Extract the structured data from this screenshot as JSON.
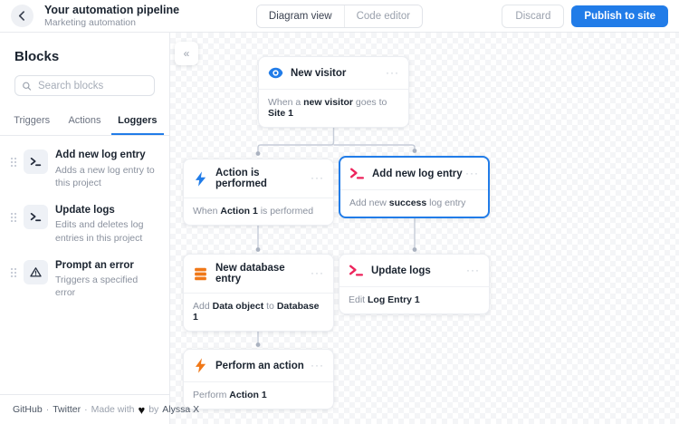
{
  "colors": {
    "accent_blue": "#217CE8",
    "icon_pink": "#ED245C",
    "icon_orange": "#F07818",
    "text_dark": "#1B2430",
    "text_muted": "#8A919E",
    "border": "#E8EAEE"
  },
  "header": {
    "title": "Your automation pipeline",
    "subtitle": "Marketing automation",
    "view_switch": {
      "diagram": "Diagram view",
      "code": "Code editor"
    },
    "discard": "Discard",
    "publish": "Publish to site"
  },
  "sidebar": {
    "title": "Blocks",
    "search": {
      "placeholder": "Search blocks"
    },
    "tabs": [
      {
        "label": "Triggers"
      },
      {
        "label": "Actions"
      },
      {
        "label": "Loggers"
      }
    ],
    "blocks": [
      {
        "icon": "terminal-icon",
        "title": "Add new log entry",
        "description": "Adds a new log entry to this project"
      },
      {
        "icon": "terminal-icon",
        "title": "Update logs",
        "description": "Edits and deletes log entries in this project"
      },
      {
        "icon": "warning-icon",
        "title": "Prompt an error",
        "description": "Triggers a specified error"
      }
    ]
  },
  "canvas": {
    "collapse_icon": "«",
    "menu_icon": "···",
    "nodes": [
      {
        "icon": "eye-icon",
        "title": "New visitor",
        "selected": false,
        "body": [
          {
            "t": "When a "
          },
          {
            "t": "new visitor",
            "b": true
          },
          {
            "t": " goes to "
          },
          {
            "t": "Site 1",
            "b": true
          }
        ]
      },
      {
        "icon": "bolt-icon",
        "title": "Action is performed",
        "selected": false,
        "body": [
          {
            "t": "When "
          },
          {
            "t": "Action 1",
            "b": true
          },
          {
            "t": " is performed"
          }
        ]
      },
      {
        "icon": "terminal-icon",
        "title": "Add new log entry",
        "selected": true,
        "body": [
          {
            "t": "Add new "
          },
          {
            "t": "success",
            "b": true
          },
          {
            "t": " log entry"
          }
        ]
      },
      {
        "icon": "database-icon",
        "title": "New database entry",
        "selected": false,
        "body": [
          {
            "t": "Add "
          },
          {
            "t": "Data object",
            "b": true
          },
          {
            "t": " to "
          },
          {
            "t": "Database 1",
            "b": true
          }
        ]
      },
      {
        "icon": "terminal-icon",
        "title": "Update logs",
        "selected": false,
        "body": [
          {
            "t": "Edit "
          },
          {
            "t": "Log Entry 1",
            "b": true
          }
        ]
      },
      {
        "icon": "bolt-icon",
        "title": "Perform an action",
        "selected": false,
        "body": [
          {
            "t": "Perform "
          },
          {
            "t": "Action 1",
            "b": true
          }
        ]
      }
    ]
  },
  "footer": {
    "github": "GitHub",
    "separator": "·",
    "twitter": "Twitter",
    "made_with": "Made with",
    "heart_icon": "♥",
    "by": "by",
    "author": "Alyssa X"
  }
}
